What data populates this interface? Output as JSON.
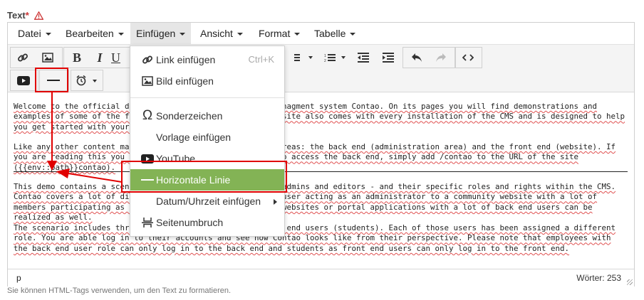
{
  "field": {
    "label": "Text",
    "required_mark": "*"
  },
  "menubar": {
    "items": [
      {
        "label": "Datei"
      },
      {
        "label": "Bearbeiten"
      },
      {
        "label": "Einfügen"
      },
      {
        "label": "Ansicht"
      },
      {
        "label": "Format"
      },
      {
        "label": "Tabelle"
      }
    ],
    "active": "Einfügen"
  },
  "toolbar": {
    "row1": [
      "link-icon",
      "image-icon",
      "bold-icon",
      "italic-icon",
      "underline-icon",
      "bullet-list-icon",
      "numbered-list-icon",
      "outdent-icon",
      "indent-icon",
      "undo-icon",
      "redo-icon",
      "code-icon"
    ],
    "row2": [
      "youtube-icon",
      "horizontal-line-icon",
      "alarm-clock-icon"
    ],
    "bold_label": "B",
    "italic_label": "I",
    "underline_label": "U"
  },
  "dropdown": {
    "items": [
      {
        "icon": "link-icon",
        "label": "Link einfügen",
        "shortcut": "Ctrl+K"
      },
      {
        "icon": "image-icon",
        "label": "Bild einfügen"
      },
      {
        "icon": "omega-icon",
        "label": "Sonderzeichen",
        "glyph": "Ω"
      },
      {
        "icon": "",
        "label": "Vorlage einfügen"
      },
      {
        "icon": "youtube-icon",
        "label": "YouTube"
      },
      {
        "icon": "horizontal-line-icon",
        "label": "Horizontale Linie",
        "selected": true
      },
      {
        "icon": "",
        "label": "Datum/Uhrzeit einfügen",
        "submenu": true
      },
      {
        "icon": "page-break-icon",
        "label": "Seitenumbruch"
      }
    ]
  },
  "content": {
    "paragraphs": [
      "Welcome to the official demo website of the Open Source managment system Contao. On its pages you will find demonstrations and examples of some of the features this CMS offers. This website also comes with every installation of the CMS and is designed to help you get started with your first web projects.",
      "Like any other content management system, Contao has two areas: the back end (administration area) and the front end (website). If you are reading this you are currently in the front end. To access the back end, simply add /contao to the URL of the site ({{env::path}}contao).",
      "This demo contains a scenario with different user roles - admins and editors - and their specific roles and rights within the CMS. Contao covers a lot of different scenarios: from a single user acting as an administrator to a community website with a lot of members participating as front end users. Complex company websites or portal applications with a lot of back end users can be realized as well.",
      "The scenario includes three back end users and three front end users (students). Each of those users has been assigned a different role. You are able log in to their accounts and see how Contao looks like from their perspective. Please note that employees with the back end user role can only log in to the back end and students as front end users can only log in to the front end."
    ]
  },
  "statusbar": {
    "path": "p",
    "word_count": "Wörter: 253"
  },
  "hint": "Sie können HTML-Tags verwenden, um den Text zu formatieren.",
  "colors": {
    "menu_selected_bg": "#83b355",
    "annotation_red": "#e00000",
    "required_red": "#cc3333"
  }
}
